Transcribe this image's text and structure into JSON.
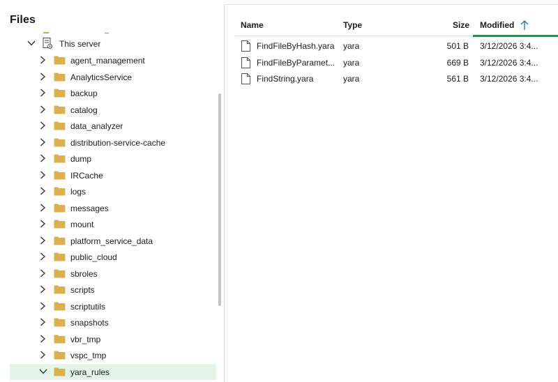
{
  "files_panel": {
    "title": "Files"
  },
  "tree": {
    "server": {
      "label": "This server",
      "expanded": true
    },
    "folders": [
      {
        "label": "agent_management",
        "expanded": false,
        "selected": false
      },
      {
        "label": "AnalyticsService",
        "expanded": false,
        "selected": false
      },
      {
        "label": "backup",
        "expanded": false,
        "selected": false
      },
      {
        "label": "catalog",
        "expanded": false,
        "selected": false
      },
      {
        "label": "data_analyzer",
        "expanded": false,
        "selected": false
      },
      {
        "label": "distribution-service-cache",
        "expanded": false,
        "selected": false
      },
      {
        "label": "dump",
        "expanded": false,
        "selected": false
      },
      {
        "label": "IRCache",
        "expanded": false,
        "selected": false
      },
      {
        "label": "logs",
        "expanded": false,
        "selected": false
      },
      {
        "label": "messages",
        "expanded": false,
        "selected": false
      },
      {
        "label": "mount",
        "expanded": false,
        "selected": false
      },
      {
        "label": "platform_service_data",
        "expanded": false,
        "selected": false
      },
      {
        "label": "public_cloud",
        "expanded": false,
        "selected": false
      },
      {
        "label": "sbroles",
        "expanded": false,
        "selected": false
      },
      {
        "label": "scripts",
        "expanded": false,
        "selected": false
      },
      {
        "label": "scriptutils",
        "expanded": false,
        "selected": false
      },
      {
        "label": "snapshots",
        "expanded": false,
        "selected": false
      },
      {
        "label": "vbr_tmp",
        "expanded": false,
        "selected": false
      },
      {
        "label": "vspc_tmp",
        "expanded": false,
        "selected": false
      },
      {
        "label": "yara_rules",
        "expanded": true,
        "selected": true
      }
    ]
  },
  "file_list": {
    "columns": {
      "name": "Name",
      "type": "Type",
      "size": "Size",
      "modified": "Modified"
    },
    "sorted_by": "Modified",
    "sort_direction": "ascending",
    "rows": [
      {
        "name": "FindFileByHash.yara",
        "type": "yara",
        "size": "501 B",
        "modified": "3/12/2026 3:4..."
      },
      {
        "name": "FindFileByParamet...",
        "type": "yara",
        "size": "669 B",
        "modified": "3/12/2026 3:4..."
      },
      {
        "name": "FindString.yara",
        "type": "yara",
        "size": "561 B",
        "modified": "3/12/2026 3:4..."
      }
    ]
  },
  "colors": {
    "folder": "#dcb04e",
    "selection": "#e4f5e8",
    "sort_accent": "#2f8a52",
    "sort_arrow": "#1f6fb2"
  },
  "icons": {
    "server": "server-icon",
    "folder": "folder-icon",
    "file": "file-icon",
    "chevron_right": "chevron-right-icon",
    "chevron_down": "chevron-down-icon",
    "sort_ascending": "arrow-up-icon"
  }
}
